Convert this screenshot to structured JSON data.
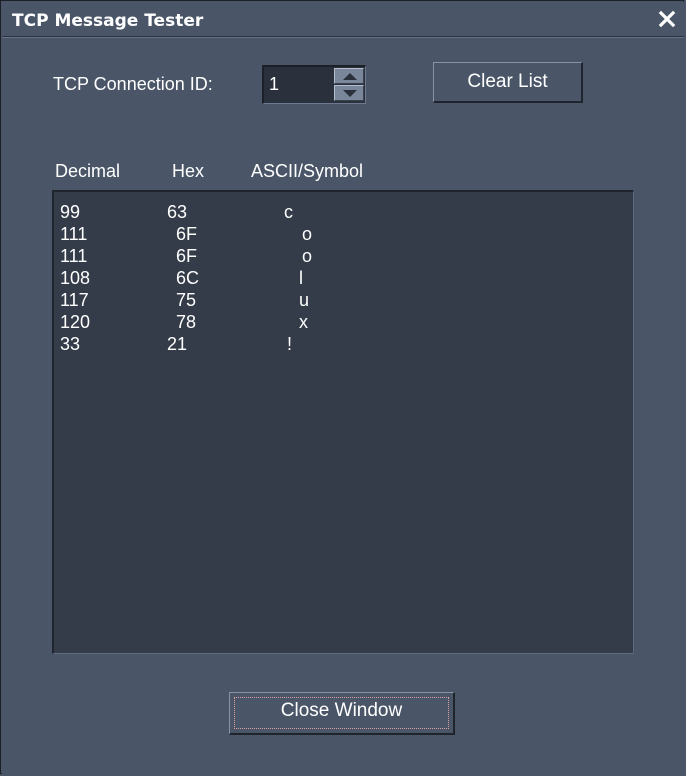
{
  "window": {
    "title": "TCP Message Tester",
    "close_icon": "close-x-icon"
  },
  "connection": {
    "label": "TCP Connection ID:",
    "value": "1"
  },
  "buttons": {
    "clear_list": "Clear List",
    "close_window": "Close Window"
  },
  "list": {
    "columns": [
      "Decimal",
      "Hex",
      "ASCII/Symbol"
    ],
    "rows": [
      {
        "decimal": "99",
        "hex": "63",
        "ascii": "c"
      },
      {
        "decimal": "111",
        "hex": "6F",
        "ascii": "o"
      },
      {
        "decimal": "111",
        "hex": "6F",
        "ascii": "o"
      },
      {
        "decimal": "108",
        "hex": "6C",
        "ascii": "l"
      },
      {
        "decimal": "117",
        "hex": "75",
        "ascii": "u"
      },
      {
        "decimal": "120",
        "hex": "78",
        "ascii": "x"
      },
      {
        "decimal": "33",
        "hex": "21",
        "ascii": "!"
      }
    ]
  },
  "colors": {
    "window_bg": "#4a5668",
    "list_bg": "#343c49",
    "text": "#ffffff"
  }
}
